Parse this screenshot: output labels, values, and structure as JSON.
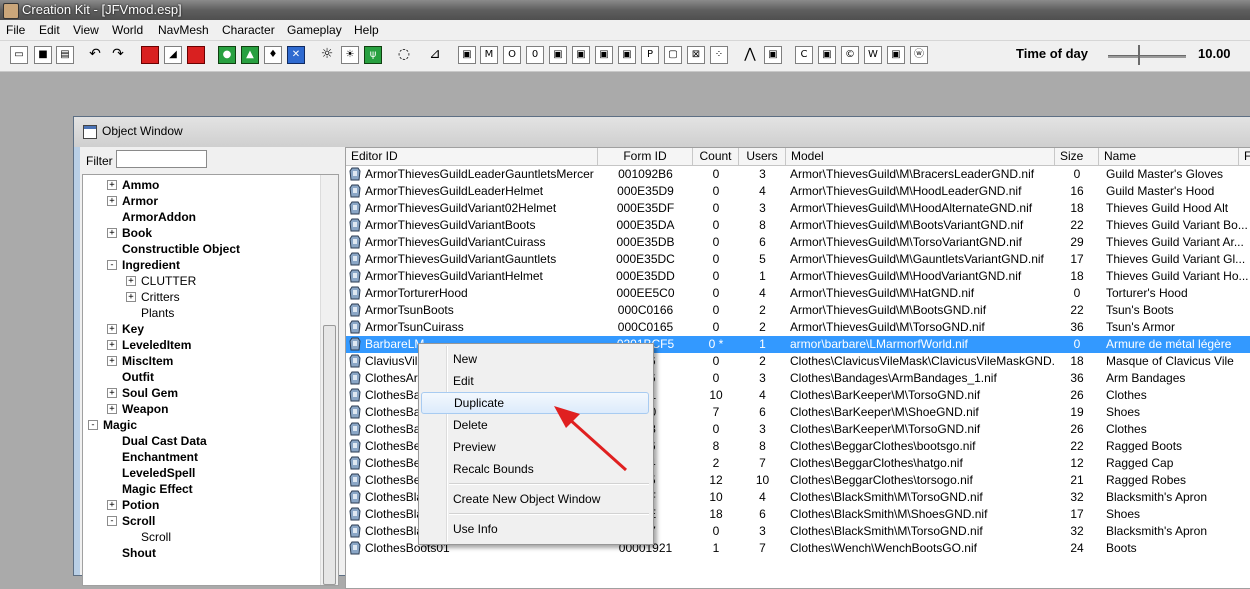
{
  "app": {
    "title": "Creation Kit - [JFVmod.esp]"
  },
  "menu": [
    "File",
    "Edit",
    "View",
    "World",
    "NavMesh",
    "Character",
    "Gameplay",
    "Help"
  ],
  "toolbar": {
    "time_of_day_label": "Time of day",
    "time_of_day_value": "10.00",
    "time_of_day_position": 0.4,
    "button_glyphs": [
      "M",
      "O",
      "0",
      "P",
      "C",
      "W"
    ]
  },
  "object_window": {
    "title": "Object Window",
    "filter_label": "Filter",
    "filter_value": "",
    "tree": [
      {
        "label": "Ammo",
        "expander": "+"
      },
      {
        "label": "Armor",
        "expander": "+"
      },
      {
        "label": "ArmorAddon",
        "expander": ""
      },
      {
        "label": "Book",
        "expander": "+"
      },
      {
        "label": "Constructible Object",
        "expander": ""
      },
      {
        "label": "Ingredient",
        "expander": "-"
      },
      {
        "label": "CLUTTER",
        "expander": "+"
      },
      {
        "label": "Critters",
        "expander": "+"
      },
      {
        "label": "Plants",
        "expander": ""
      },
      {
        "label": "Key",
        "expander": "+"
      },
      {
        "label": "LeveledItem",
        "expander": "+"
      },
      {
        "label": "MiscItem",
        "expander": "+"
      },
      {
        "label": "Outfit",
        "expander": ""
      },
      {
        "label": "Soul Gem",
        "expander": "+"
      },
      {
        "label": "Weapon",
        "expander": "+"
      },
      {
        "label": "Magic",
        "expander": "-"
      },
      {
        "label": "Dual Cast Data",
        "expander": ""
      },
      {
        "label": "Enchantment",
        "expander": ""
      },
      {
        "label": "LeveledSpell",
        "expander": ""
      },
      {
        "label": "Magic Effect",
        "expander": ""
      },
      {
        "label": "Potion",
        "expander": "+"
      },
      {
        "label": "Scroll",
        "expander": "-"
      },
      {
        "label": "Scroll",
        "expander": ""
      },
      {
        "label": "Shout",
        "expander": ""
      }
    ],
    "columns": [
      "Editor ID",
      "Form ID",
      "Count",
      "Users",
      "Model",
      "Size",
      "Name",
      "F"
    ],
    "rows": [
      {
        "id": "ArmorThievesGuildLeaderGauntletsMercer",
        "form": "001092B6",
        "count": "0",
        "users": "3",
        "model": "Armor\\ThievesGuild\\M\\BracersLeaderGND.nif",
        "size": "0",
        "name": "Guild Master's Gloves"
      },
      {
        "id": "ArmorThievesGuildLeaderHelmet",
        "form": "000E35D9",
        "count": "0",
        "users": "4",
        "model": "Armor\\ThievesGuild\\M\\HoodLeaderGND.nif",
        "size": "16",
        "name": "Guild Master's Hood"
      },
      {
        "id": "ArmorThievesGuildVariant02Helmet",
        "form": "000E35DF",
        "count": "0",
        "users": "3",
        "model": "Armor\\ThievesGuild\\M\\HoodAlternateGND.nif",
        "size": "18",
        "name": "Thieves Guild Hood Alt"
      },
      {
        "id": "ArmorThievesGuildVariantBoots",
        "form": "000E35DA",
        "count": "0",
        "users": "8",
        "model": "Armor\\ThievesGuild\\M\\BootsVariantGND.nif",
        "size": "22",
        "name": "Thieves Guild Variant Bo..."
      },
      {
        "id": "ArmorThievesGuildVariantCuirass",
        "form": "000E35DB",
        "count": "0",
        "users": "6",
        "model": "Armor\\ThievesGuild\\M\\TorsoVariantGND.nif",
        "size": "29",
        "name": "Thieves Guild Variant Ar..."
      },
      {
        "id": "ArmorThievesGuildVariantGauntlets",
        "form": "000E35DC",
        "count": "0",
        "users": "5",
        "model": "Armor\\ThievesGuild\\M\\GauntletsVariantGND.nif",
        "size": "17",
        "name": "Thieves Guild Variant Gl..."
      },
      {
        "id": "ArmorThievesGuildVariantHelmet",
        "form": "000E35DD",
        "count": "0",
        "users": "1",
        "model": "Armor\\ThievesGuild\\M\\HoodVariantGND.nif",
        "size": "18",
        "name": "Thieves Guild Variant Ho..."
      },
      {
        "id": "ArmorTorturerHood",
        "form": "000EE5C0",
        "count": "0",
        "users": "4",
        "model": "Armor\\ThievesGuild\\M\\HatGND.nif",
        "size": "0",
        "name": "Torturer's Hood"
      },
      {
        "id": "ArmorTsunBoots",
        "form": "000C0166",
        "count": "0",
        "users": "2",
        "model": "Armor\\ThievesGuild\\M\\BootsGND.nif",
        "size": "22",
        "name": "Tsun's Boots"
      },
      {
        "id": "ArmorTsunCuirass",
        "form": "000C0165",
        "count": "0",
        "users": "2",
        "model": "Armor\\ThievesGuild\\M\\TorsoGND.nif",
        "size": "36",
        "name": "Tsun's Armor"
      },
      {
        "id": "BarbareLM",
        "form": "0201BCF5",
        "count": "0 *",
        "users": "1",
        "model": "armor\\barbare\\LMarmorfWorld.nif",
        "size": "0",
        "name": "Armure de métal légère",
        "selected": true
      },
      {
        "id": "ClaviusVil",
        "form": "846",
        "count": "0",
        "users": "2",
        "model": "Clothes\\ClavicusVileMask\\ClavicusVileMaskGND.nif",
        "size": "18",
        "name": "Masque of Clavicus Vile"
      },
      {
        "id": "ClothesArm",
        "form": "006",
        "count": "0",
        "users": "3",
        "model": "Clothes\\Bandages\\ArmBandages_1.nif",
        "size": "36",
        "name": "Arm Bandages"
      },
      {
        "id": "ClothesBar",
        "form": "6A1",
        "count": "10",
        "users": "4",
        "model": "Clothes\\BarKeeper\\M\\TorsoGND.nif",
        "size": "26",
        "name": "Clothes"
      },
      {
        "id": "ClothesBar",
        "form": "6A0",
        "count": "7",
        "users": "6",
        "model": "Clothes\\BarKeeper\\M\\ShoeGND.nif",
        "size": "19",
        "name": "Shoes"
      },
      {
        "id": "ClothesBar",
        "form": "F38",
        "count": "0",
        "users": "3",
        "model": "Clothes\\BarKeeper\\M\\TorsoGND.nif",
        "size": "26",
        "name": "Clothes"
      },
      {
        "id": "ClothesBeg",
        "form": "106",
        "count": "8",
        "users": "8",
        "model": "Clothes\\BeggarClothes\\bootsgo.nif",
        "size": "22",
        "name": "Ragged Boots"
      },
      {
        "id": "ClothesBeg",
        "form": "104",
        "count": "2",
        "users": "7",
        "model": "Clothes\\BeggarClothes\\hatgo.nif",
        "size": "12",
        "name": "Ragged Cap"
      },
      {
        "id": "ClothesBeg",
        "form": "105",
        "count": "12",
        "users": "10",
        "model": "Clothes\\BeggarClothes\\torsogo.nif",
        "size": "21",
        "name": "Ragged Robes"
      },
      {
        "id": "ClothesBla",
        "form": "69F",
        "count": "10",
        "users": "4",
        "model": "Clothes\\BlackSmith\\M\\TorsoGND.nif",
        "size": "32",
        "name": "Blacksmith's Apron"
      },
      {
        "id": "ClothesBla",
        "form": "69E",
        "count": "18",
        "users": "6",
        "model": "Clothes\\BlackSmith\\M\\ShoesGND.nif",
        "size": "17",
        "name": "Shoes"
      },
      {
        "id": "ClothesBla",
        "form": "F37",
        "count": "0",
        "users": "3",
        "model": "Clothes\\BlackSmith\\M\\TorsoGND.nif",
        "size": "32",
        "name": "Blacksmith's Apron"
      },
      {
        "id": "ClothesBoots01",
        "form": "00001921",
        "count": "1",
        "users": "7",
        "model": "Clothes\\Wench\\WenchBootsGO.nif",
        "size": "24",
        "name": "Boots"
      }
    ]
  },
  "context_menu": {
    "items": [
      "New",
      "Edit",
      "Duplicate",
      "Delete",
      "Preview",
      "Recalc Bounds",
      "Create New Object Window",
      "Use Info"
    ],
    "highlighted": "Duplicate"
  },
  "colors": {
    "selection": "#3399ff",
    "annotation_arrow": "#e02020"
  }
}
